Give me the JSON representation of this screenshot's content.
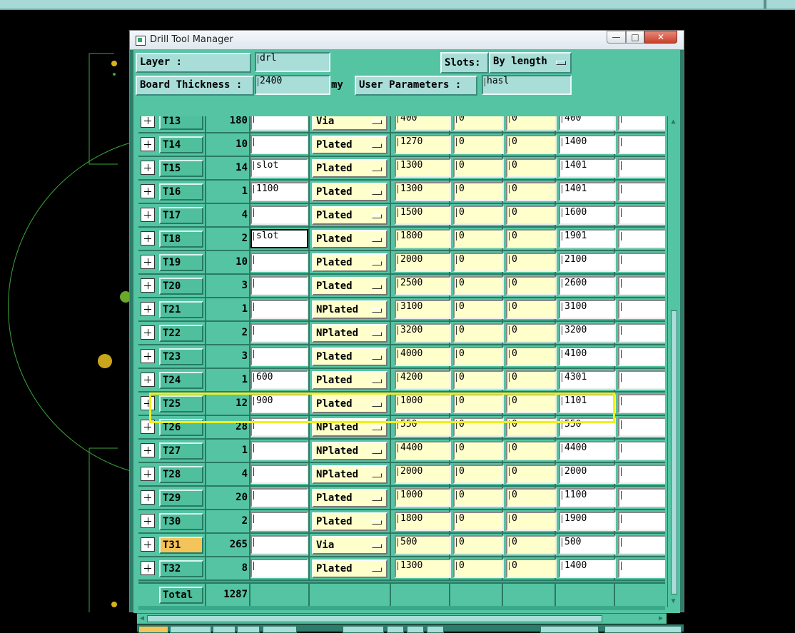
{
  "window": {
    "title": "Drill Tool Manager"
  },
  "title_buttons": {
    "minimize": "—",
    "maximize": "□",
    "close": "✕"
  },
  "header": {
    "layer_label": "Layer        :",
    "layer_value": "drl",
    "slots_label": "Slots:",
    "slots_value": "By length",
    "thickness_label": "Board Thickness :",
    "thickness_value": "2400",
    "thickness_unit": "my",
    "user_params_label": "User Parameters :",
    "user_params_value": "hasl"
  },
  "rows": [
    {
      "tool": "T13",
      "count": "180",
      "slot": "",
      "type": "Via",
      "c1": "400",
      "c2": "0",
      "c3": "0",
      "c4": "400",
      "c5": ""
    },
    {
      "tool": "T14",
      "count": "10",
      "slot": "",
      "type": "Plated",
      "c1": "1270",
      "c2": "0",
      "c3": "0",
      "c4": "1400",
      "c5": ""
    },
    {
      "tool": "T15",
      "count": "14",
      "slot": "slot",
      "type": "Plated",
      "c1": "1300",
      "c2": "0",
      "c3": "0",
      "c4": "1401",
      "c5": ""
    },
    {
      "tool": "T16",
      "count": "1",
      "slot": "1100",
      "type": "Plated",
      "c1": "1300",
      "c2": "0",
      "c3": "0",
      "c4": "1401",
      "c5": ""
    },
    {
      "tool": "T17",
      "count": "4",
      "slot": "",
      "type": "Plated",
      "c1": "1500",
      "c2": "0",
      "c3": "0",
      "c4": "1600",
      "c5": ""
    },
    {
      "tool": "T18",
      "count": "2",
      "slot": "slot",
      "type": "Plated",
      "c1": "1800",
      "c2": "0",
      "c3": "0",
      "c4": "1901",
      "c5": ""
    },
    {
      "tool": "T19",
      "count": "10",
      "slot": "",
      "type": "Plated",
      "c1": "2000",
      "c2": "0",
      "c3": "0",
      "c4": "2100",
      "c5": ""
    },
    {
      "tool": "T20",
      "count": "3",
      "slot": "",
      "type": "Plated",
      "c1": "2500",
      "c2": "0",
      "c3": "0",
      "c4": "2600",
      "c5": ""
    },
    {
      "tool": "T21",
      "count": "1",
      "slot": "",
      "type": "NPlated",
      "c1": "3100",
      "c2": "0",
      "c3": "0",
      "c4": "3100",
      "c5": ""
    },
    {
      "tool": "T22",
      "count": "2",
      "slot": "",
      "type": "NPlated",
      "c1": "3200",
      "c2": "0",
      "c3": "0",
      "c4": "3200",
      "c5": ""
    },
    {
      "tool": "T23",
      "count": "3",
      "slot": "",
      "type": "Plated",
      "c1": "4000",
      "c2": "0",
      "c3": "0",
      "c4": "4100",
      "c5": ""
    },
    {
      "tool": "T24",
      "count": "1",
      "slot": "600",
      "type": "Plated",
      "c1": "4200",
      "c2": "0",
      "c3": "0",
      "c4": "4301",
      "c5": ""
    },
    {
      "tool": "T25",
      "count": "12",
      "slot": "900",
      "type": "Plated",
      "c1": "1000",
      "c2": "0",
      "c3": "0",
      "c4": "1101",
      "c5": ""
    },
    {
      "tool": "T26",
      "count": "28",
      "slot": "",
      "type": "NPlated",
      "c1": "550",
      "c2": "0",
      "c3": "0",
      "c4": "550",
      "c5": ""
    },
    {
      "tool": "T27",
      "count": "1",
      "slot": "",
      "type": "NPlated",
      "c1": "4400",
      "c2": "0",
      "c3": "0",
      "c4": "4400",
      "c5": ""
    },
    {
      "tool": "T28",
      "count": "4",
      "slot": "",
      "type": "NPlated",
      "c1": "2000",
      "c2": "0",
      "c3": "0",
      "c4": "2000",
      "c5": ""
    },
    {
      "tool": "T29",
      "count": "20",
      "slot": "",
      "type": "Plated",
      "c1": "1000",
      "c2": "0",
      "c3": "0",
      "c4": "1100",
      "c5": ""
    },
    {
      "tool": "T30",
      "count": "2",
      "slot": "",
      "type": "Plated",
      "c1": "1800",
      "c2": "0",
      "c3": "0",
      "c4": "1900",
      "c5": ""
    },
    {
      "tool": "T31",
      "count": "265",
      "slot": "",
      "type": "Via",
      "c1": "500",
      "c2": "0",
      "c3": "0",
      "c4": "500",
      "c5": ""
    },
    {
      "tool": "T32",
      "count": "8",
      "slot": "",
      "type": "Plated",
      "c1": "1300",
      "c2": "0",
      "c3": "0",
      "c4": "1400",
      "c5": ""
    }
  ],
  "total": {
    "label": "Total",
    "count": "1287"
  },
  "scroll": {
    "up": "▲",
    "down": "▼",
    "left": "◀",
    "right": "▶"
  },
  "colors": {
    "panel": "#55c4a2",
    "field": "#a8ddd8",
    "yellow_cell": "#ffffcc",
    "selected_tool": "#f4c45a",
    "highlight": "#f0f021"
  }
}
